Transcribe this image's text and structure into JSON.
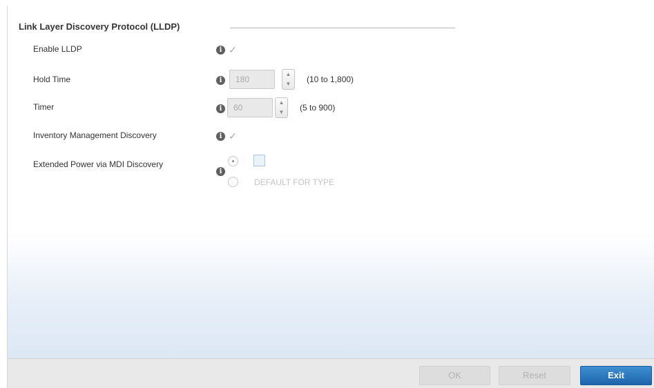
{
  "section": {
    "title": "Link Layer Discovery Protocol (LLDP)"
  },
  "rows": {
    "enable_lldp": {
      "label": "Enable LLDP",
      "checked": true
    },
    "hold_time": {
      "label": "Hold Time",
      "value": "180",
      "range": "(10 to 1,800)"
    },
    "timer": {
      "label": "Timer",
      "value": "60",
      "range": "(5 to 900)"
    },
    "inventory": {
      "label": "Inventory Management Discovery",
      "checked": true
    },
    "extended_power": {
      "label": "Extended Power via MDI Discovery",
      "option_default": "DEFAULT FOR TYPE"
    }
  },
  "icons": {
    "info": "i",
    "check": "✓",
    "spin_up": "▲",
    "spin_down": "▼"
  },
  "footer": {
    "ok_label": "OK",
    "reset_label": "Reset",
    "exit_label": "Exit"
  },
  "colors": {
    "primary_button": "#2a74bd",
    "info_icon": "#5f5f5f",
    "disabled_text": "#b3b3b3"
  }
}
